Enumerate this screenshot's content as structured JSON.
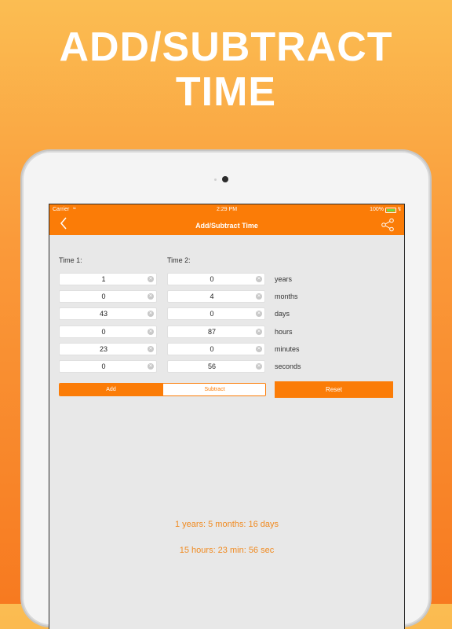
{
  "headline": {
    "line1": "ADD/SUBTRACT",
    "line2": "TIME"
  },
  "status_bar": {
    "carrier": "Carrier",
    "time": "2:29 PM",
    "battery": "100%"
  },
  "nav": {
    "title": "Add/Subtract Time",
    "back_icon": "chevron-left-icon",
    "share_icon": "share-icon"
  },
  "labels": {
    "time1": "Time 1:",
    "time2": "Time 2:"
  },
  "rows": [
    {
      "time1": "1",
      "time2": "0",
      "unit": "years"
    },
    {
      "time1": "0",
      "time2": "4",
      "unit": "months"
    },
    {
      "time1": "43",
      "time2": "0",
      "unit": "days"
    },
    {
      "time1": "0",
      "time2": "87",
      "unit": "hours"
    },
    {
      "time1": "23",
      "time2": "0",
      "unit": "minutes"
    },
    {
      "time1": "0",
      "time2": "56",
      "unit": "seconds"
    }
  ],
  "segment": {
    "add": "Add",
    "subtract": "Subtract",
    "selected": "Add"
  },
  "reset_label": "Reset",
  "result": {
    "line1": "1 years: 5 months: 16 days",
    "line2": "15 hours: 23 min: 56 sec"
  },
  "colors": {
    "accent": "#fb7c07",
    "result_text": "#f08a20",
    "background": "#e8e8e8"
  }
}
